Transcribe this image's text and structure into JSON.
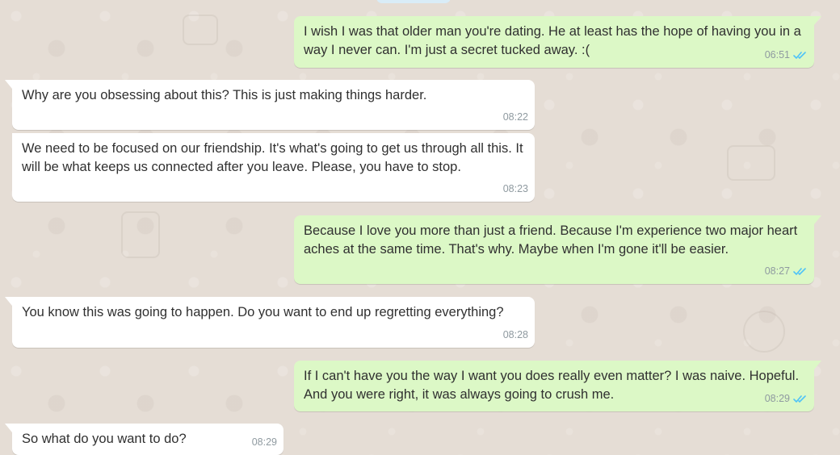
{
  "chat": {
    "colors": {
      "wallpaper": "#e5ddd5",
      "incoming_bubble": "#ffffff",
      "outgoing_bubble": "#dcf8c6",
      "tick_read": "#4fc3f7"
    },
    "messages": [
      {
        "direction": "outgoing",
        "text": "I wish I was that older man you're dating. He at least has the hope of having you in a way I never can. I'm just a secret tucked away. :(",
        "time": "06:51",
        "status_icon": "double-check-read-icon"
      },
      {
        "direction": "incoming",
        "text": "Why are you obsessing about this? This is just making things harder.",
        "time": "08:22"
      },
      {
        "direction": "incoming",
        "text": "We need to be focused on our friendship. It's what's going to get us through all this. It will be what keeps us connected after you leave. Please, you have to stop.",
        "time": "08:23"
      },
      {
        "direction": "outgoing",
        "text": "Because I love you more than just a friend. Because I'm experience two major heart aches at the same time. That's why. Maybe when I'm gone it'll be easier.",
        "time": "08:27",
        "status_icon": "double-check-read-icon"
      },
      {
        "direction": "incoming",
        "text": "You know this was going to happen. Do you want to end up regretting everything?",
        "time": "08:28"
      },
      {
        "direction": "outgoing",
        "text": "If I can't have you the way I want you does really even matter? I was naive. Hopeful. And you were right, it was always going to crush me.",
        "time": "08:29",
        "status_icon": "double-check-read-icon"
      },
      {
        "direction": "incoming",
        "text": "So what do you want to do?",
        "time": "08:29"
      }
    ]
  }
}
